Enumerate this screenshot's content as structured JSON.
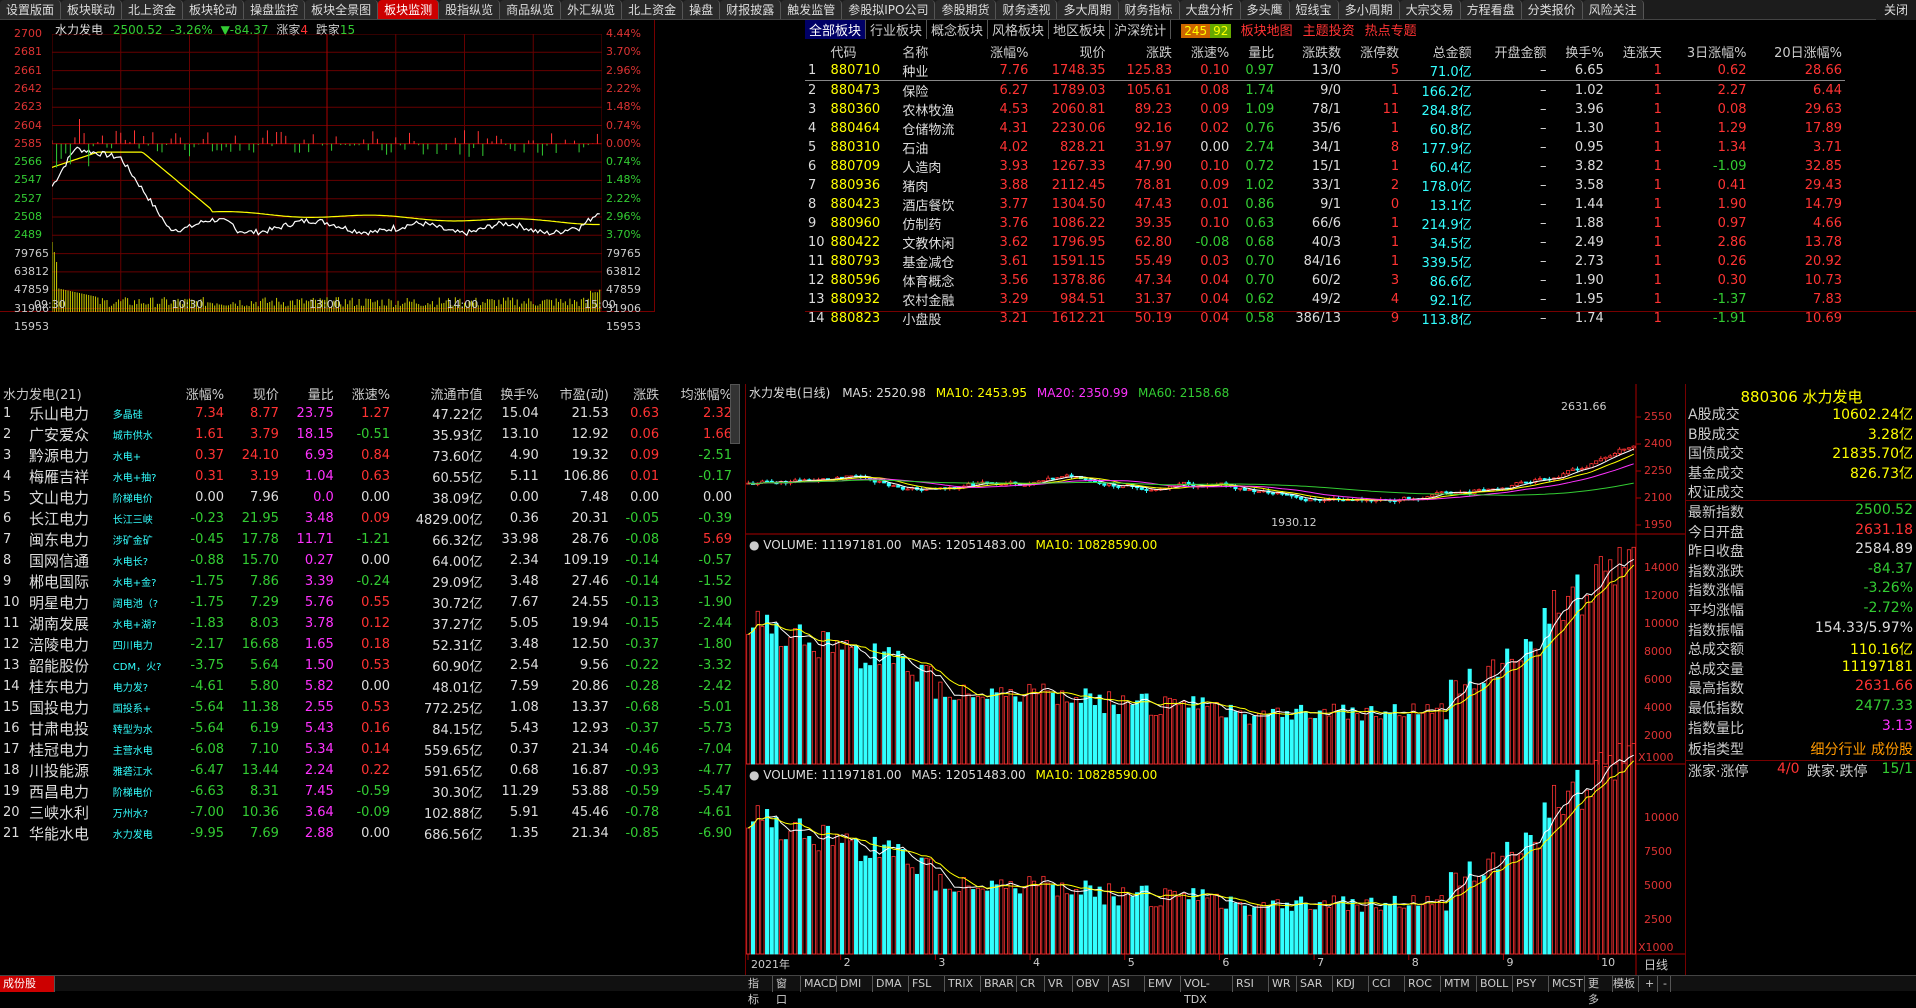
{
  "top_tabs": [
    "设置版面",
    "板块联动",
    "北上资金",
    "板块轮动",
    "操盘监控",
    "板块全景图",
    "板块监测",
    "股指纵览",
    "商品纵览",
    "外汇纵览",
    "北上资金",
    "操盘",
    "财报披露",
    "触发监管",
    "参股拟IPO公司",
    "参股期货",
    "财务透视",
    "多大周期",
    "财务指标",
    "大盘分析",
    "多头鹰",
    "短线宝",
    "多小周期",
    "大宗交易",
    "方程看盘",
    "分类报价",
    "风险关注"
  ],
  "active_tab": "板块监测",
  "window_close_label": "关闭",
  "intraday": {
    "stock_name": "水力发电",
    "price": "2500.52",
    "change_pct": "-3.26%",
    "change": "▼-84.37",
    "up_label": "涨家",
    "up_count": "4",
    "down_label": "跌家",
    "down_count": "15",
    "left_axis": [
      "2700",
      "2681",
      "2661",
      "2642",
      "2623",
      "2604",
      "2585",
      "2566",
      "2547",
      "2527",
      "2508",
      "2489",
      "79765",
      "63812",
      "47859",
      "31906",
      "15953"
    ],
    "right_axis": [
      "4.44%",
      "3.70%",
      "2.96%",
      "2.22%",
      "1.48%",
      "0.74%",
      "0.00%",
      "0.74%",
      "1.48%",
      "2.22%",
      "2.96%",
      "3.70%",
      "79765",
      "63812",
      "47859",
      "31906",
      "15953"
    ],
    "time_labels": [
      "09:30",
      "10:30",
      "13:00",
      "14:00",
      "15:00"
    ]
  },
  "sector_tabs": [
    "全部板块",
    "行业板块",
    "概念板块",
    "风格板块",
    "地区板块",
    "沪深统计"
  ],
  "sector_badge_red": "245",
  "sector_badge_green": "92",
  "sector_links": [
    "板块地图",
    "主题投资",
    "热点专题"
  ],
  "sector_headers": [
    "",
    "代码",
    "名称",
    "涨幅%",
    "现价",
    "涨跌",
    "涨速%",
    "量比",
    "涨跌数",
    "涨停数",
    "总金额",
    "开盘金额",
    "换手%",
    "连涨天",
    "3日涨幅%",
    "20日涨幅%"
  ],
  "sectors": [
    [
      "1",
      "880710",
      "种业",
      "7.76",
      "1748.35",
      "125.83",
      "0.10",
      "0.97",
      "13/0",
      "5",
      "71.0亿",
      "–",
      "6.65",
      "1",
      "0.62",
      "28.66"
    ],
    [
      "2",
      "880473",
      "保险",
      "6.27",
      "1789.03",
      "105.61",
      "0.08",
      "1.74",
      "9/0",
      "1",
      "166.2亿",
      "–",
      "1.02",
      "1",
      "2.27",
      "6.44"
    ],
    [
      "3",
      "880360",
      "农林牧渔",
      "4.53",
      "2060.81",
      "89.23",
      "0.09",
      "1.09",
      "78/1",
      "11",
      "284.8亿",
      "–",
      "3.96",
      "1",
      "0.08",
      "29.63"
    ],
    [
      "4",
      "880464",
      "仓储物流",
      "4.31",
      "2230.06",
      "92.16",
      "0.02",
      "0.76",
      "35/6",
      "1",
      "60.8亿",
      "–",
      "1.30",
      "1",
      "1.29",
      "17.89"
    ],
    [
      "5",
      "880310",
      "石油",
      "4.02",
      "828.21",
      "31.97",
      "0.00",
      "2.74",
      "34/1",
      "8",
      "177.9亿",
      "–",
      "0.95",
      "1",
      "1.34",
      "3.71"
    ],
    [
      "6",
      "880709",
      "人造肉",
      "3.93",
      "1267.33",
      "47.90",
      "0.10",
      "0.72",
      "15/1",
      "1",
      "60.4亿",
      "–",
      "3.82",
      "1",
      "-1.09",
      "32.85"
    ],
    [
      "7",
      "880936",
      "猪肉",
      "3.88",
      "2112.45",
      "78.81",
      "0.09",
      "1.02",
      "33/1",
      "2",
      "178.0亿",
      "–",
      "3.58",
      "1",
      "0.41",
      "29.43"
    ],
    [
      "8",
      "880423",
      "酒店餐饮",
      "3.77",
      "1304.50",
      "47.43",
      "0.01",
      "0.86",
      "9/1",
      "0",
      "13.1亿",
      "–",
      "1.44",
      "1",
      "1.90",
      "14.79"
    ],
    [
      "9",
      "880960",
      "仿制药",
      "3.76",
      "1086.22",
      "39.35",
      "0.10",
      "0.63",
      "66/6",
      "1",
      "214.9亿",
      "–",
      "1.88",
      "1",
      "0.97",
      "4.66"
    ],
    [
      "10",
      "880422",
      "文教休闲",
      "3.62",
      "1796.95",
      "62.80",
      "-0.08",
      "0.68",
      "40/3",
      "1",
      "34.5亿",
      "–",
      "2.49",
      "1",
      "2.86",
      "13.78"
    ],
    [
      "11",
      "880793",
      "基金减仓",
      "3.61",
      "1591.15",
      "55.49",
      "0.03",
      "0.70",
      "84/16",
      "1",
      "339.5亿",
      "–",
      "2.73",
      "1",
      "0.26",
      "20.92"
    ],
    [
      "12",
      "880596",
      "体育概念",
      "3.56",
      "1378.86",
      "47.34",
      "0.04",
      "0.70",
      "60/2",
      "3",
      "86.6亿",
      "–",
      "1.90",
      "1",
      "0.30",
      "10.73"
    ],
    [
      "13",
      "880932",
      "农村金融",
      "3.29",
      "984.51",
      "31.37",
      "0.04",
      "0.62",
      "49/2",
      "4",
      "92.1亿",
      "–",
      "1.95",
      "1",
      "-1.37",
      "7.83"
    ],
    [
      "14",
      "880823",
      "小盘股",
      "3.21",
      "1612.21",
      "50.19",
      "0.04",
      "0.58",
      "386/13",
      "9",
      "113.8亿",
      "–",
      "1.74",
      "1",
      "-1.91",
      "10.69"
    ]
  ],
  "stock_list_title": "水力发电(21)",
  "stock_headers": [
    "",
    "",
    "涨幅%",
    "现价",
    "量比",
    "涨速%",
    "流通市值",
    "换手%",
    "市盈(动)",
    "涨跌",
    "均涨幅%"
  ],
  "stocks": [
    [
      "1",
      "乐山电力",
      "多晶硅",
      "7.34",
      "8.77",
      "23.75",
      "1.27",
      "47.22亿",
      "15.04",
      "21.53",
      "0.63",
      "2.32"
    ],
    [
      "2",
      "广安爱众",
      "城市供水",
      "1.61",
      "3.79",
      "18.15",
      "-0.51",
      "35.93亿",
      "13.10",
      "12.92",
      "0.06",
      "1.66"
    ],
    [
      "3",
      "黔源电力",
      "水电+",
      "0.37",
      "24.10",
      "6.93",
      "0.84",
      "73.60亿",
      "4.90",
      "19.32",
      "0.09",
      "-2.51"
    ],
    [
      "4",
      "梅雁吉祥",
      "水电+抽?",
      "0.31",
      "3.19",
      "1.04",
      "0.63",
      "60.55亿",
      "5.11",
      "106.86",
      "0.01",
      "-0.17"
    ],
    [
      "5",
      "文山电力",
      "阶梯电价",
      "0.00",
      "7.96",
      "0.0",
      "0.00",
      "38.09亿",
      "0.00",
      "7.48",
      "0.00",
      "0.00"
    ],
    [
      "6",
      "长江电力",
      "长江三峡",
      "-0.23",
      "21.95",
      "3.48",
      "0.09",
      "4829.00亿",
      "0.36",
      "20.31",
      "-0.05",
      "-0.39"
    ],
    [
      "7",
      "闽东电力",
      "涉矿金矿",
      "-0.45",
      "17.78",
      "11.71",
      "-1.21",
      "66.32亿",
      "33.98",
      "28.76",
      "-0.08",
      "5.69"
    ],
    [
      "8",
      "国网信通",
      "水电长?",
      "-0.88",
      "15.70",
      "0.27",
      "0.00",
      "64.00亿",
      "2.34",
      "109.19",
      "-0.14",
      "-0.57"
    ],
    [
      "9",
      "郴电国际",
      "水电+金?",
      "-1.75",
      "7.86",
      "3.39",
      "-0.24",
      "29.09亿",
      "3.48",
      "27.46",
      "-0.14",
      "-1.52"
    ],
    [
      "10",
      "明星电力",
      "阔电池（?",
      "-1.75",
      "7.29",
      "5.76",
      "0.55",
      "30.72亿",
      "7.67",
      "24.55",
      "-0.13",
      "-1.90"
    ],
    [
      "11",
      "湖南发展",
      "水电+湖?",
      "-1.83",
      "8.03",
      "3.78",
      "0.12",
      "37.27亿",
      "5.05",
      "19.94",
      "-0.15",
      "-2.44"
    ],
    [
      "12",
      "涪陵电力",
      "四川电力",
      "-2.17",
      "16.68",
      "1.65",
      "0.18",
      "52.31亿",
      "3.48",
      "12.50",
      "-0.37",
      "-1.80"
    ],
    [
      "13",
      "韶能股份",
      "CDM，火?",
      "-3.75",
      "5.64",
      "1.50",
      "0.53",
      "60.90亿",
      "2.54",
      "9.56",
      "-0.22",
      "-3.32"
    ],
    [
      "14",
      "桂东电力",
      "电力发?",
      "-4.61",
      "5.80",
      "5.82",
      "0.00",
      "48.01亿",
      "7.59",
      "20.86",
      "-0.28",
      "-2.42"
    ],
    [
      "15",
      "国投电力",
      "国投系+",
      "-5.64",
      "11.38",
      "2.55",
      "0.53",
      "772.25亿",
      "1.08",
      "13.37",
      "-0.68",
      "-5.01"
    ],
    [
      "16",
      "甘肃电投",
      "转型为水",
      "-5.64",
      "6.19",
      "5.43",
      "0.16",
      "84.15亿",
      "5.43",
      "12.93",
      "-0.37",
      "-5.73"
    ],
    [
      "17",
      "桂冠电力",
      "主营水电",
      "-6.08",
      "7.10",
      "5.34",
      "0.14",
      "559.65亿",
      "0.37",
      "21.34",
      "-0.46",
      "-7.04"
    ],
    [
      "18",
      "川投能源",
      "雅砻江水",
      "-6.47",
      "13.44",
      "2.24",
      "0.22",
      "591.65亿",
      "0.68",
      "16.87",
      "-0.93",
      "-4.77"
    ],
    [
      "19",
      "西昌电力",
      "阶梯电价",
      "-6.63",
      "8.31",
      "7.45",
      "-0.59",
      "30.30亿",
      "11.29",
      "53.88",
      "-0.59",
      "-5.47"
    ],
    [
      "20",
      "三峡水利",
      "万州水?",
      "-7.00",
      "10.36",
      "3.64",
      "-0.09",
      "102.88亿",
      "5.91",
      "45.46",
      "-0.78",
      "-4.61"
    ],
    [
      "21",
      "华能水电",
      "水力发电",
      "-9.95",
      "7.69",
      "2.88",
      "0.00",
      "686.56亿",
      "1.35",
      "21.34",
      "-0.85",
      "-6.90"
    ]
  ],
  "daily": {
    "title": "水力发电(日线)",
    "ma5": "MA5: 2520.98",
    "ma10": "MA10: 2453.95",
    "ma20": "MA20: 2350.99",
    "ma60": "MA60: 2158.68",
    "high_mark": "2631.66",
    "low_mark": "1930.12",
    "price_axis": [
      "2550",
      "2400",
      "2250",
      "2100",
      "1950"
    ],
    "vol_header": "VOLUME: 11197181.00",
    "vol_ma5": "MA5: 12051483.00",
    "vol_ma10": "MA10: 10828590.00",
    "vol_axis": [
      "14000",
      "12000",
      "10000",
      "8000",
      "6000",
      "4000",
      "2000"
    ],
    "vol_unit": "X1000",
    "vol2_axis": [
      "10000",
      "7500",
      "5000",
      "2500"
    ],
    "date_labels": [
      "2021年",
      "2",
      "3",
      "4",
      "5",
      "6",
      "7",
      "8",
      "9",
      "10"
    ],
    "period_label": "日线"
  },
  "info_panel": {
    "title": "880306 水力发电",
    "rows": [
      [
        "A股成交",
        "10602.24亿",
        "yw"
      ],
      [
        "B股成交",
        "3.28亿",
        "yw"
      ],
      [
        "国债成交",
        "21835.70亿",
        "yw"
      ],
      [
        "基金成交",
        "826.73亿",
        "yw"
      ],
      [
        "权证成交",
        "",
        "yw"
      ],
      [
        "最新指数",
        "2500.52",
        "gr"
      ],
      [
        "今日开盘",
        "2631.18",
        "r"
      ],
      [
        "昨日收盘",
        "2584.89",
        "wh"
      ],
      [
        "指数涨跌",
        "-84.37",
        "gr"
      ],
      [
        "指数涨幅",
        "-3.26%",
        "gr"
      ],
      [
        "平均涨幅",
        "-2.72%",
        "gr"
      ],
      [
        "指数振幅",
        "154.33/5.97%",
        "wh"
      ],
      [
        "总成交额",
        "110.16亿",
        "yw"
      ],
      [
        "总成交量",
        "11197181",
        "yw"
      ],
      [
        "最高指数",
        "2631.66",
        "r"
      ],
      [
        "最低指数",
        "2477.33",
        "gr"
      ],
      [
        "指数量比",
        "3.13",
        "mg"
      ]
    ],
    "type_label": "板指类型",
    "type_value": "细分行业 成份股",
    "rise_label": "涨家·涨停",
    "rise_value": "4/0",
    "fall_label": "跌家·跌停",
    "fall_value": "15/1"
  },
  "bottom_tabs": [
    "成份股",
    "指标",
    "窗口",
    "MACD",
    "DMI",
    "DMA",
    "FSL",
    "TRIX",
    "BRAR",
    "CR",
    "VR",
    "OBV",
    "ASI",
    "EMV",
    "VOL-TDX",
    "RSI",
    "WR",
    "SAR",
    "KDJ",
    "CCI",
    "ROC",
    "MTM",
    "BOLL",
    "PSY",
    "MCST",
    "更多"
  ],
  "bottom_right": [
    "模板",
    "+",
    "-"
  ]
}
